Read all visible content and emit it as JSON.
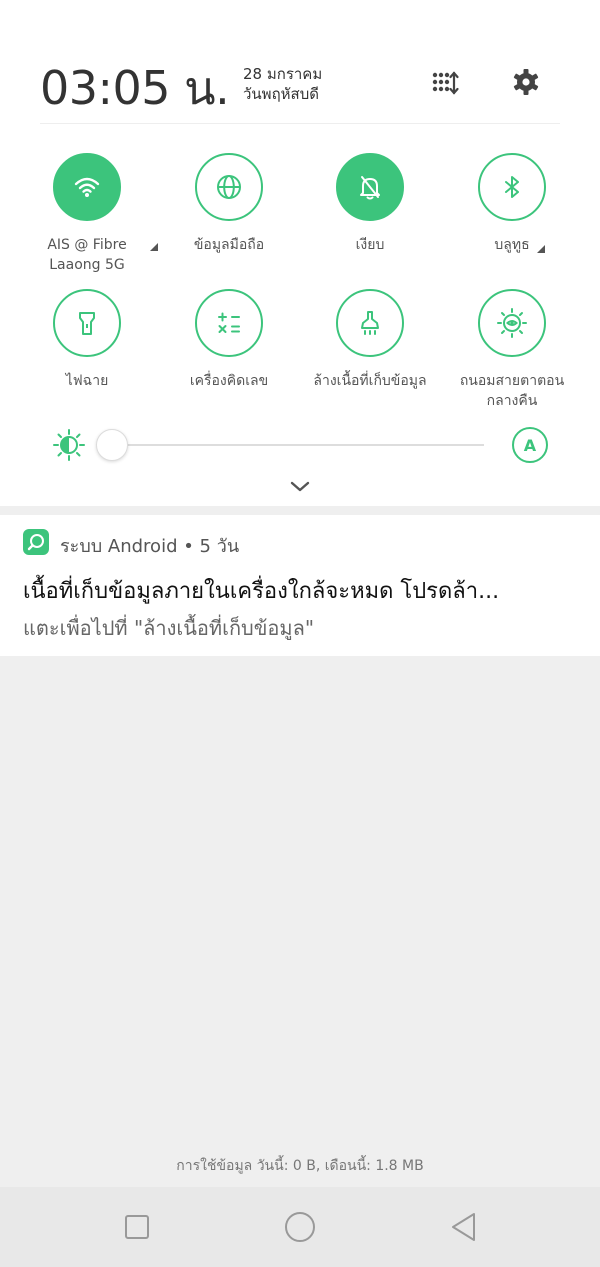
{
  "status": {
    "time": "03:05 น.",
    "date_line1": "28 มกราคม",
    "date_line2": "วันพฤหัสบดี"
  },
  "tiles": [
    {
      "label_line1": "AIS @ Fibre",
      "label_line2": "Laaong 5G",
      "icon": "wifi-icon",
      "active": true
    },
    {
      "label_line1": "ข้อมูลมือถือ",
      "label_line2": "",
      "icon": "globe-icon",
      "active": false
    },
    {
      "label_line1": "เงียบ",
      "label_line2": "",
      "icon": "bell-off-icon",
      "active": true
    },
    {
      "label_line1": "บลูทูธ",
      "label_line2": "",
      "icon": "bluetooth-icon",
      "active": false
    },
    {
      "label_line1": "ไฟฉาย",
      "label_line2": "",
      "icon": "flashlight-icon",
      "active": false
    },
    {
      "label_line1": "เครื่องคิดเลข",
      "label_line2": "",
      "icon": "calculator-icon",
      "active": false
    },
    {
      "label_line1": "ล้างเนื้อที่เก็บข้อมูล",
      "label_line2": "",
      "icon": "broom-icon",
      "active": false
    },
    {
      "label_line1": "ถนอมสายตาตอน",
      "label_line2": "กลางคืน",
      "icon": "eye-comfort-icon",
      "active": false
    }
  ],
  "brightness": {
    "level": 0.0,
    "auto_label": "A"
  },
  "notification": {
    "app_line": "ระบบ Android • 5 วัน",
    "title": "เนื้อที่เก็บข้อมูลภายในเครื่องใกล้จะหมด โปรดล้า...",
    "body": "แตะเพื่อไปที่ \"ล้างเนื้อที่เก็บข้อมูล\""
  },
  "data_usage": "การใช้ข้อมูล วันนี้: 0 B, เดือนนี้: 1.8 MB",
  "colors": {
    "accent": "#3cc47c",
    "panel_bg": "#ffffff",
    "screen_bg": "#efefef"
  }
}
